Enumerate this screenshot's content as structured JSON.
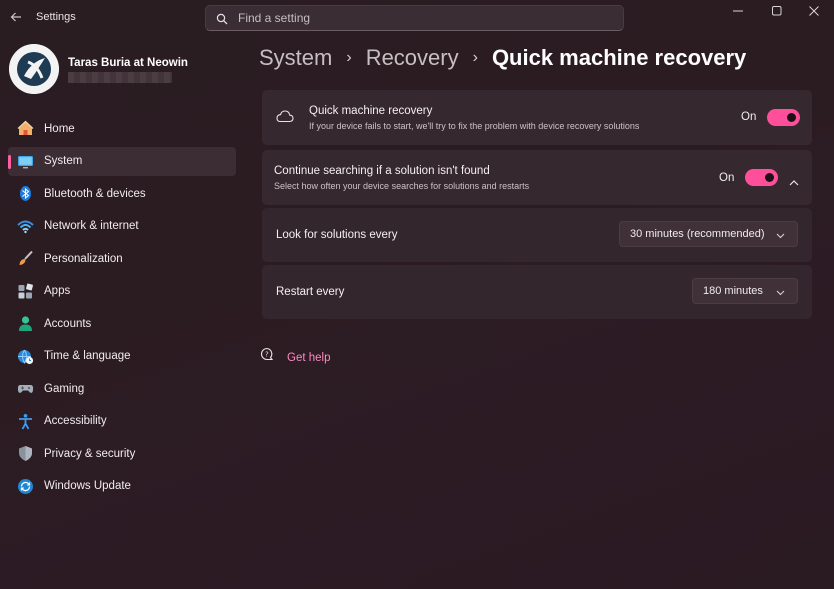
{
  "app": {
    "title": "Settings"
  },
  "search": {
    "placeholder": "Find a setting"
  },
  "profile": {
    "name": "Taras Buria at Neowin"
  },
  "nav": {
    "items": [
      {
        "label": "Home",
        "icon": "home-icon"
      },
      {
        "label": "System",
        "icon": "system-icon",
        "active": true
      },
      {
        "label": "Bluetooth & devices",
        "icon": "bluetooth-icon"
      },
      {
        "label": "Network & internet",
        "icon": "wifi-icon"
      },
      {
        "label": "Personalization",
        "icon": "brush-icon"
      },
      {
        "label": "Apps",
        "icon": "apps-icon"
      },
      {
        "label": "Accounts",
        "icon": "accounts-icon"
      },
      {
        "label": "Time & language",
        "icon": "globe-clock-icon"
      },
      {
        "label": "Gaming",
        "icon": "gamepad-icon"
      },
      {
        "label": "Accessibility",
        "icon": "accessibility-icon"
      },
      {
        "label": "Privacy & security",
        "icon": "shield-icon"
      },
      {
        "label": "Windows Update",
        "icon": "update-icon"
      }
    ]
  },
  "breadcrumb": {
    "items": [
      "System",
      "Recovery"
    ],
    "current": "Quick machine recovery"
  },
  "settings": {
    "qmr": {
      "title": "Quick machine recovery",
      "subtitle": "If your device fails to start, we'll try to fix the problem with device recovery solutions",
      "state": "On",
      "on": true
    },
    "continue": {
      "title": "Continue searching if a solution isn't found",
      "subtitle": "Select how often your device searches for solutions and restarts",
      "state": "On",
      "on": true,
      "expanded": true
    },
    "look_for": {
      "label": "Look for solutions every",
      "value": "30 minutes (recommended)"
    },
    "restart": {
      "label": "Restart every",
      "value": "180 minutes"
    }
  },
  "help": {
    "label": "Get help"
  },
  "colors": {
    "accent": "#ff4f9a",
    "link": "#ff8ac0",
    "card": "#35282e"
  }
}
